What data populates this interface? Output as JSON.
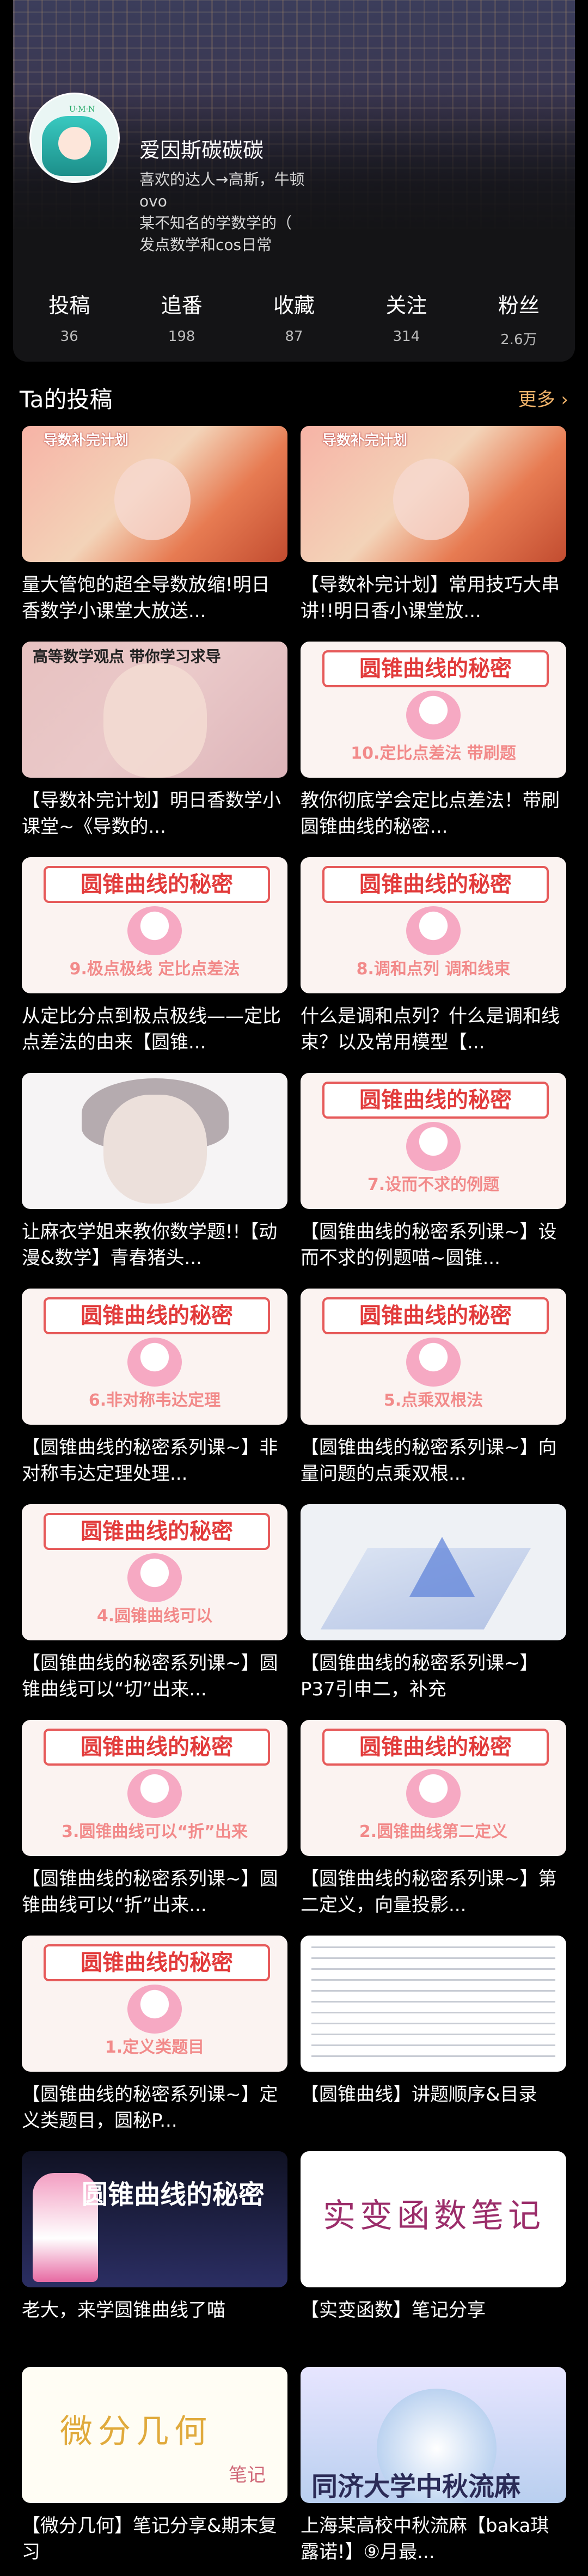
{
  "profile": {
    "name": "爱因斯碳碳碳",
    "bio_lines": [
      "喜欢的达人→高斯，牛顿",
      "ovo",
      "某不知名的学数学的（",
      "发点数学和cos日常"
    ],
    "avatar_tag": "U·M·N"
  },
  "stats": [
    {
      "label": "投稿",
      "value": "36"
    },
    {
      "label": "追番",
      "value": "198"
    },
    {
      "label": "收藏",
      "value": "87"
    },
    {
      "label": "关注",
      "value": "314"
    },
    {
      "label": "粉丝",
      "value": "2.6万"
    }
  ],
  "section": {
    "title": "Ta的投稿",
    "more": "更多 ›"
  },
  "posts": [
    {
      "title": "量大管饱的超全导数放缩!明日香数学小课堂大放送...",
      "thumb": "cos",
      "thumb_text": "导数补完计划"
    },
    {
      "title": "【导数补完计划】常用技巧大串讲!!明日香小课堂放...",
      "thumb": "cos",
      "thumb_text": "导数补完计划"
    },
    {
      "title": "【导数补完计划】明日香数学小课堂~《导数的...",
      "thumb": "cos2",
      "thumb_text": "高等数学观点 带你学习求导"
    },
    {
      "title": "教你彻底学会定比点差法！带刷圆锥曲线的秘密...",
      "thumb": "circle",
      "thumb_text": "10.定比点差法 带刷题"
    },
    {
      "title": "从定比分点到极点极线——定比点差法的由来【圆锥...",
      "thumb": "circle",
      "thumb_text": "9.极点极线 定比点差法"
    },
    {
      "title": "什么是调和点列？什么是调和线束？以及常用模型【...",
      "thumb": "circle",
      "thumb_text": "8.调和点列 调和线束"
    },
    {
      "title": "让麻衣学姐来教你数学题!!【动漫&数学】青春猪头...",
      "thumb": "cat",
      "thumb_text": ""
    },
    {
      "title": "【圆锥曲线的秘密系列课~】设而不求的例题喵~圆锥...",
      "thumb": "circle",
      "thumb_text": "7.设而不求的例题"
    },
    {
      "title": "【圆锥曲线的秘密系列课~】非对称韦达定理处理...",
      "thumb": "circle",
      "thumb_text": "6.非对称韦达定理"
    },
    {
      "title": "【圆锥曲线的秘密系列课~】向量问题的点乘双根...",
      "thumb": "circle",
      "thumb_text": "5.点乘双根法"
    },
    {
      "title": "【圆锥曲线的秘密系列课~】圆锥曲线可以“切”出来...",
      "thumb": "circle",
      "thumb_text": "4.圆锥曲线可以"
    },
    {
      "title": "【圆锥曲线的秘密系列课~】P37引申二，补充",
      "thumb": "wide",
      "thumb_text": ""
    },
    {
      "title": "【圆锥曲线的秘密系列课~】圆锥曲线可以“折”出来...",
      "thumb": "circle",
      "thumb_text": "3.圆锥曲线可以“折”出来"
    },
    {
      "title": "【圆锥曲线的秘密系列课~】第二定义，向量投影...",
      "thumb": "circle",
      "thumb_text": "2.圆锥曲线第二定义"
    },
    {
      "title": "【圆锥曲线的秘密系列课~】定义类题目，圆秘P...",
      "thumb": "circle",
      "thumb_text": "1.定义类题目"
    },
    {
      "title": "【圆锥曲线】讲题顺序&目录",
      "thumb": "doc",
      "thumb_text": ""
    },
    {
      "title": "老大，来学圆锥曲线了喵",
      "thumb": "dark",
      "thumb_text": "圆锥曲线的秘密"
    },
    {
      "title": "【实变函数】笔记分享",
      "thumb": "note",
      "thumb_text": "实变函数笔记"
    },
    {
      "title": "【微分几何】笔记分享&期末复习",
      "thumb": "note2",
      "thumb_text": "微分几何"
    },
    {
      "title": "上海某高校中秋流麻【baka琪露诺!】⑨月最...",
      "thumb": "anime",
      "thumb_text": "同济大学中秋流麻"
    }
  ],
  "banner_text": "圆锥曲线的秘密",
  "note_small_text": "笔记"
}
